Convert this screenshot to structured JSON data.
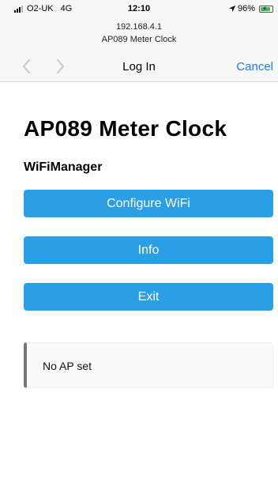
{
  "status_bar": {
    "carrier": "O2-UK",
    "network": "4G",
    "time": "12:10",
    "battery_percent": "96%",
    "battery_level": 0.96
  },
  "browser": {
    "host": "192.168.4.1",
    "page_title": "AP089 Meter Clock",
    "nav_title": "Log In",
    "cancel_label": "Cancel"
  },
  "page": {
    "title": "AP089 Meter Clock",
    "subtitle": "WiFiManager",
    "buttons": {
      "configure": "Configure WiFi",
      "info": "Info",
      "exit": "Exit"
    },
    "message": "No AP set"
  },
  "colors": {
    "accent": "#2b9fe6",
    "link": "#1a7df0",
    "battery": "#3fc04f",
    "message_border": "#777777"
  },
  "icons": {
    "back": "chevron-left-icon",
    "forward": "chevron-right-icon",
    "signal": "signal-icon",
    "location": "location-arrow-icon",
    "battery": "battery-charging-icon"
  }
}
